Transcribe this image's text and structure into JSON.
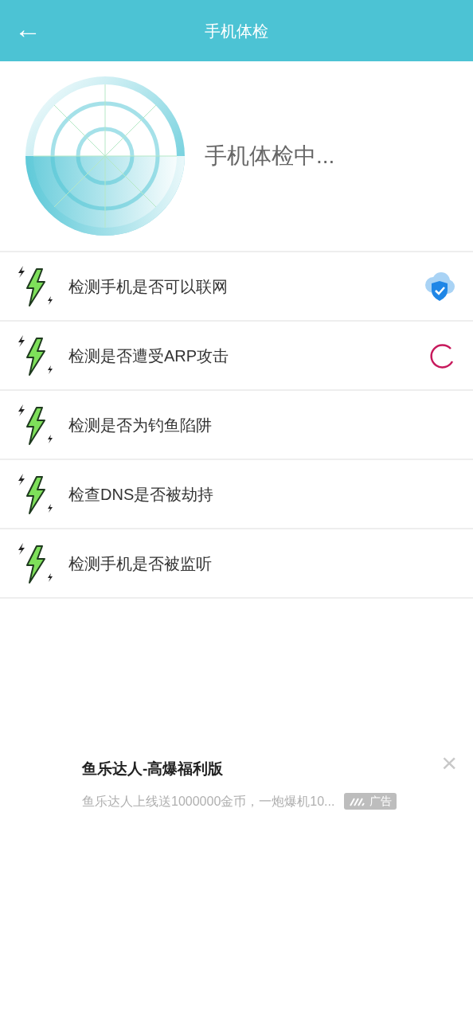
{
  "header": {
    "back": "←",
    "title": "手机体检"
  },
  "scan": {
    "status_text": "手机体检中..."
  },
  "checks": [
    {
      "label": "检测手机是否可以联网",
      "passed": true,
      "in_progress": false
    },
    {
      "label": "检测是否遭受ARP攻击",
      "passed": false,
      "in_progress": true
    },
    {
      "label": "检测是否为钓鱼陷阱",
      "passed": false,
      "in_progress": false
    },
    {
      "label": "检查DNS是否被劫持",
      "passed": false,
      "in_progress": false
    },
    {
      "label": "检测手机是否被监听",
      "passed": false,
      "in_progress": false
    }
  ],
  "ad": {
    "title": "鱼乐达人-高爆福利版",
    "description": "鱼乐达人上线送1000000金币，一炮爆机10...",
    "badge": "广告",
    "close": "×"
  }
}
